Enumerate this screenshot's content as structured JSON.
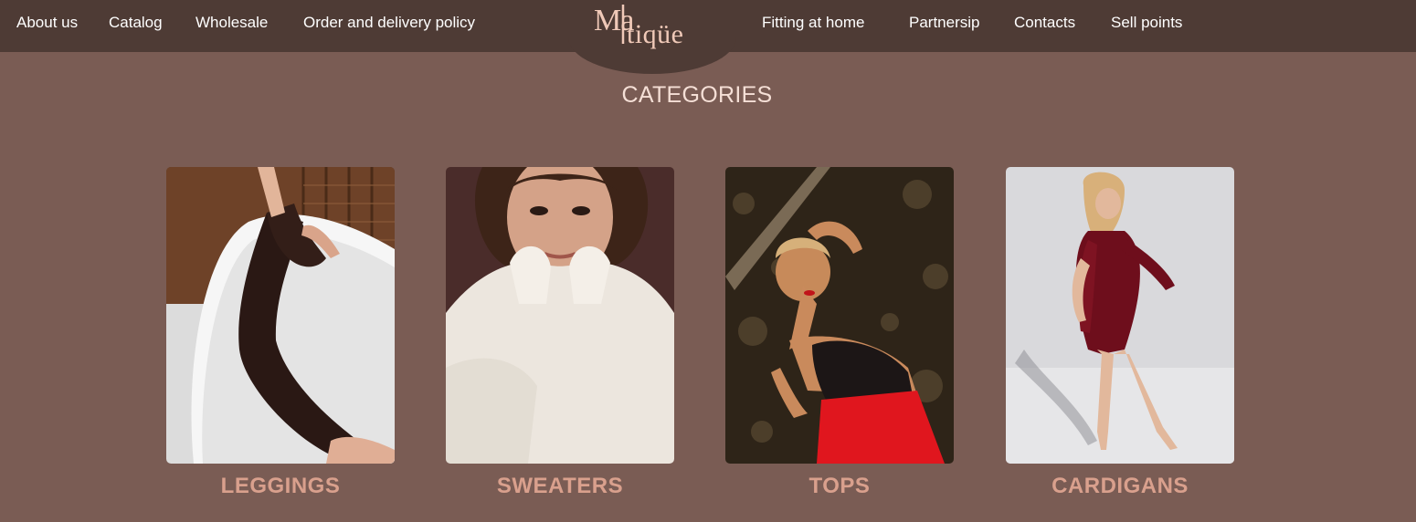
{
  "nav": {
    "left": [
      "About us",
      "Catalog",
      "Wholesale",
      "Order and delivery policy"
    ],
    "right": [
      "Fitting at home",
      "Partnersip",
      "Contacts",
      "Sell points"
    ]
  },
  "logo": {
    "text": "Malitique"
  },
  "section": {
    "title": "CATEGORIES"
  },
  "categories": [
    {
      "label": "LEGGINGS",
      "image": "woman in black leather leggings lying in white bathtub"
    },
    {
      "label": "SWEATERS",
      "image": "woman in fluffy white sweater"
    },
    {
      "label": "TOPS",
      "image": "woman in black corset top and red skirt"
    },
    {
      "label": "CARDIGANS",
      "image": "woman in burgundy cardigan on light backdrop"
    }
  ],
  "colors": {
    "background": "#7a5c54",
    "topbar": "#4e3b35",
    "nav_text": "#ffffff",
    "title_text": "#f5dfd6",
    "label_text": "#d9a08d",
    "logo_text": "#f0c9b8"
  }
}
